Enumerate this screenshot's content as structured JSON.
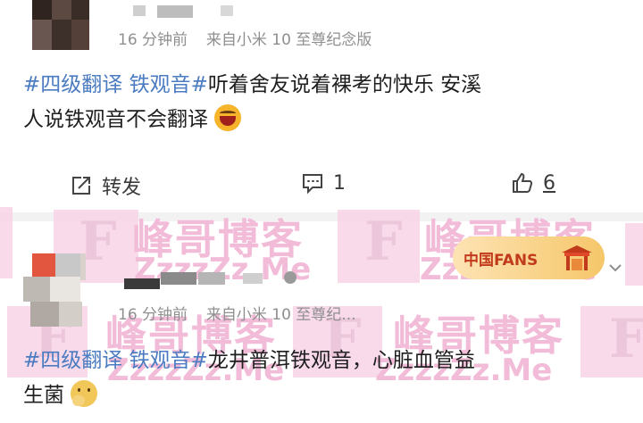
{
  "post1": {
    "timestamp": "16 分钟前",
    "source": "来自小米 10 至尊纪念版",
    "hashtag": "#四级翻译 铁观音#",
    "text_line1": "听着舍友说着裸考的快乐  安溪",
    "text_line2": "人说铁观音不会翻译",
    "emoji": "laughing-face-icon",
    "actions": {
      "repost_label": "转发",
      "comment_count": "1",
      "like_count": "6"
    }
  },
  "post2": {
    "timestamp": "16 分钟前",
    "source": "来自小米 10 至尊纪...",
    "hashtag": "#四级翻译 铁观音#",
    "text_line1": "龙井普洱铁观音，心脏血管益",
    "text_line2": "生菌",
    "emoji": "thinking-face-icon",
    "badge": "中国FANS"
  },
  "watermark": {
    "brand": "峰哥博客",
    "domain": "ZzzzZz.Me",
    "letter": "F"
  },
  "colors": {
    "hashtag": "#4b7bc1",
    "meta": "#8f8f8f",
    "watermark": "#f2bcd8"
  }
}
